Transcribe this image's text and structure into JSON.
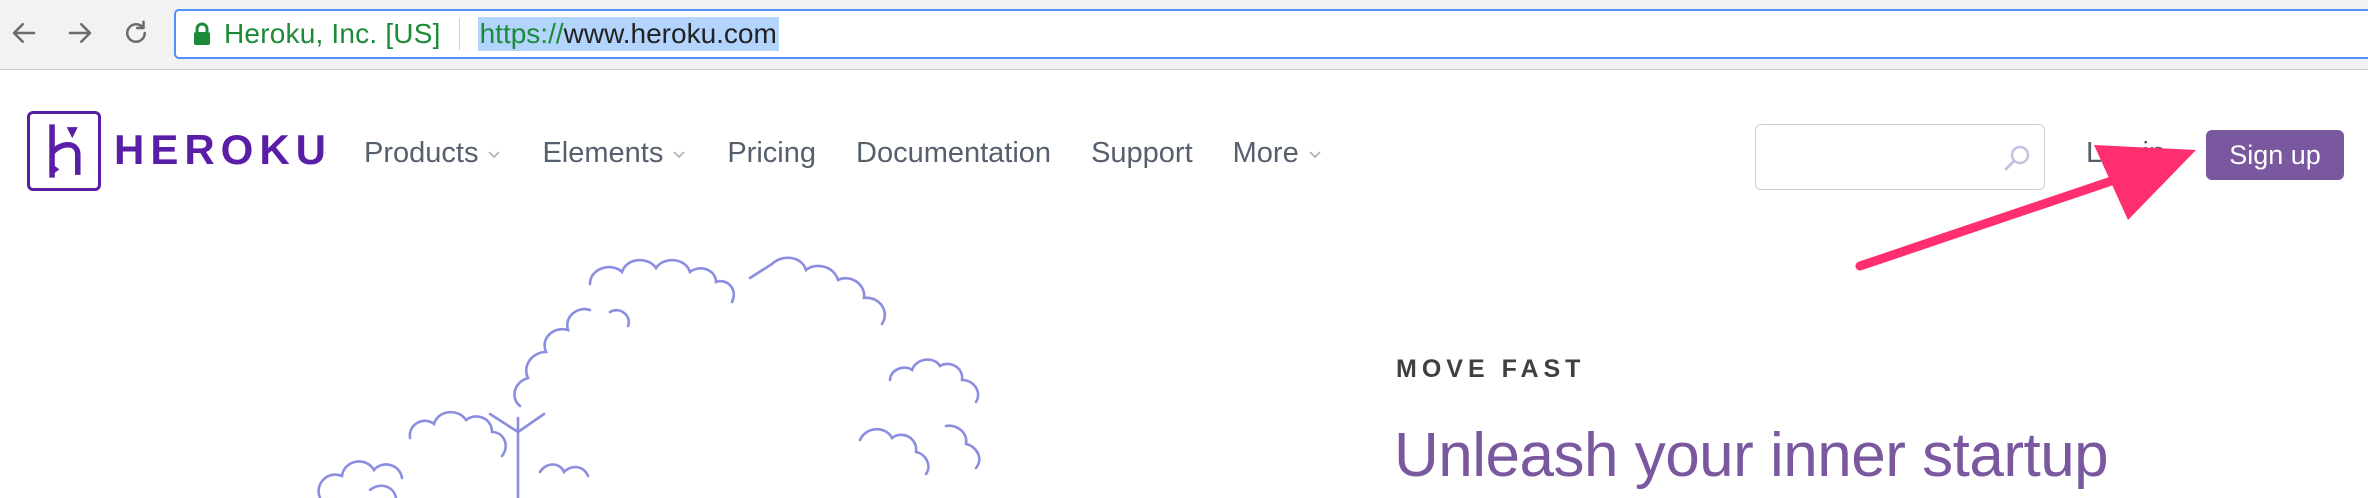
{
  "browser": {
    "site_identity": "Heroku, Inc. [US]",
    "url_scheme": "https://",
    "url_host": "www.heroku.com"
  },
  "header": {
    "logo_text": "HEROKU",
    "nav": [
      {
        "label": "Products",
        "has_dropdown": true
      },
      {
        "label": "Elements",
        "has_dropdown": true
      },
      {
        "label": "Pricing",
        "has_dropdown": false
      },
      {
        "label": "Documentation",
        "has_dropdown": false
      },
      {
        "label": "Support",
        "has_dropdown": false
      },
      {
        "label": "More",
        "has_dropdown": true
      }
    ],
    "search_placeholder": "",
    "login_label": "Log in",
    "signup_label": "Sign up"
  },
  "hero": {
    "eyebrow": "MOVE FAST",
    "headline": "Unleash your inner startup"
  },
  "colors": {
    "brand_purple": "#79589f",
    "logo_purple": "#5a1ea6",
    "arrow_pink": "#ff2e6e",
    "secure_green": "#1c8a36"
  },
  "icons": [
    "back-icon",
    "forward-icon",
    "reload-icon",
    "lock-icon",
    "heroku-logo-icon",
    "search-icon",
    "chevron-down-icon"
  ]
}
